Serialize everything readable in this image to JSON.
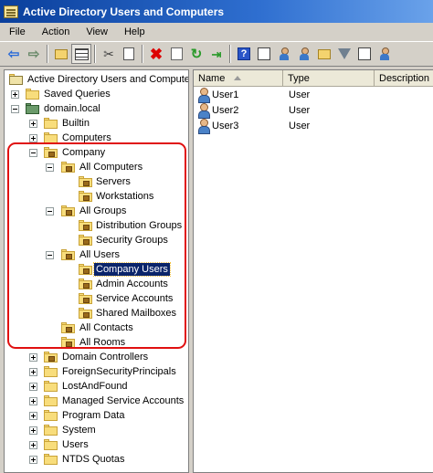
{
  "window": {
    "title": "Active Directory Users and Computers"
  },
  "menu": [
    "File",
    "Action",
    "View",
    "Help"
  ],
  "toolbar": {
    "icons": [
      "back-arrow-icon",
      "forward-arrow-icon",
      "folder-up-icon",
      "show-tree-icon",
      "cut-icon",
      "clipboard-icon",
      "delete-icon",
      "properties-icon",
      "refresh-icon",
      "export-list-icon",
      "help-icon",
      "console-doc-icon",
      "new-user-icon",
      "new-group-icon",
      "new-ou-icon",
      "filter-icon",
      "find-icon",
      "add-to-group-icon"
    ]
  },
  "tree": {
    "root": "Active Directory Users and Computers",
    "saved_queries": "Saved Queries",
    "domain": "domain.local",
    "builtin": "Builtin",
    "computers": "Computers",
    "company": "Company",
    "all_computers": "All Computers",
    "servers": "Servers",
    "workstations": "Workstations",
    "all_groups": "All Groups",
    "distribution_groups": "Distribution Groups",
    "security_groups": "Security Groups",
    "all_users": "All Users",
    "company_users": "Company Users",
    "admin_accounts": "Admin Accounts",
    "service_accounts": "Service Accounts",
    "shared_mailboxes": "Shared Mailboxes",
    "all_contacts": "All Contacts",
    "all_rooms": "All Rooms",
    "domain_controllers": "Domain Controllers",
    "foreign_security_principals": "ForeignSecurityPrincipals",
    "lost_and_found": "LostAndFound",
    "managed_service_accounts": "Managed Service Accounts",
    "program_data": "Program Data",
    "system": "System",
    "users": "Users",
    "ntds_quotas": "NTDS Quotas"
  },
  "list": {
    "columns": {
      "name": "Name",
      "type": "Type",
      "description": "Description"
    },
    "rows": [
      {
        "name": "User1",
        "type": "User"
      },
      {
        "name": "User2",
        "type": "User"
      },
      {
        "name": "User3",
        "type": "User"
      }
    ]
  }
}
